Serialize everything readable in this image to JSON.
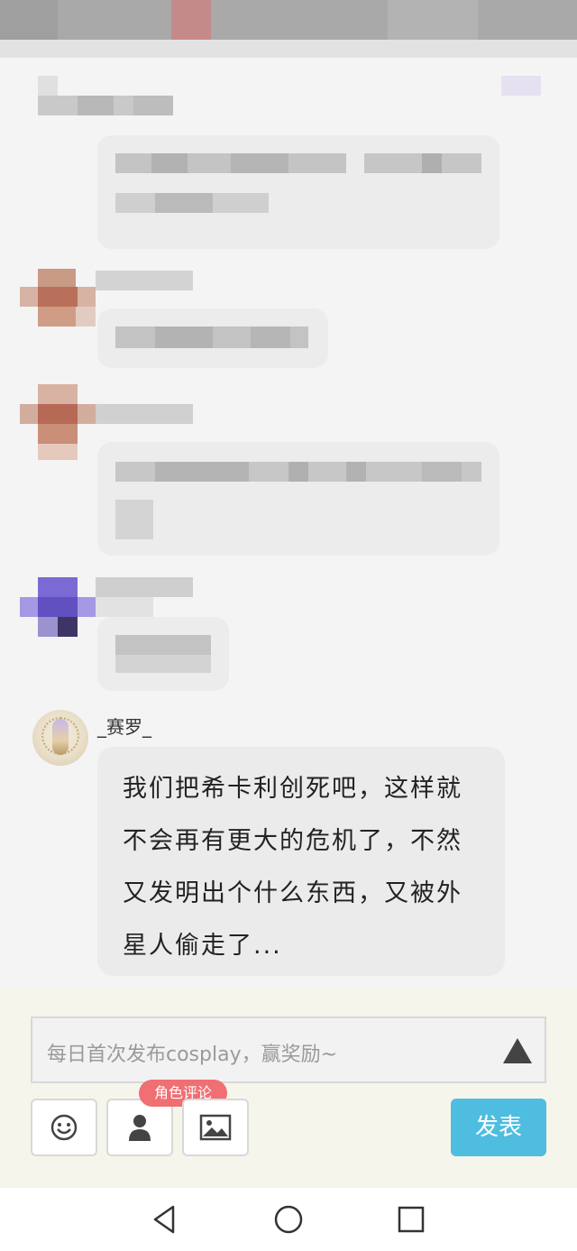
{
  "message": {
    "username": "_赛罗_",
    "lines": [
      "我们把希卡利创死吧，这样就",
      "不会再有更大的危机了，不然",
      "又发明出个什么东西，又被外",
      "星人偷走了..."
    ]
  },
  "composer": {
    "placeholder": "每日首次发布cosplay，赢奖励~",
    "role_badge": "角色评论",
    "post_label": "发表"
  },
  "icons": {
    "send": "triangle-up-icon",
    "emoji": "smiley-icon",
    "role": "person-icon",
    "image": "image-icon",
    "nav_back": "triangle-left-icon",
    "nav_home": "circle-icon",
    "nav_recent": "square-icon"
  },
  "colors": {
    "post_button": "#4fbde0",
    "badge": "#ef6f73"
  }
}
